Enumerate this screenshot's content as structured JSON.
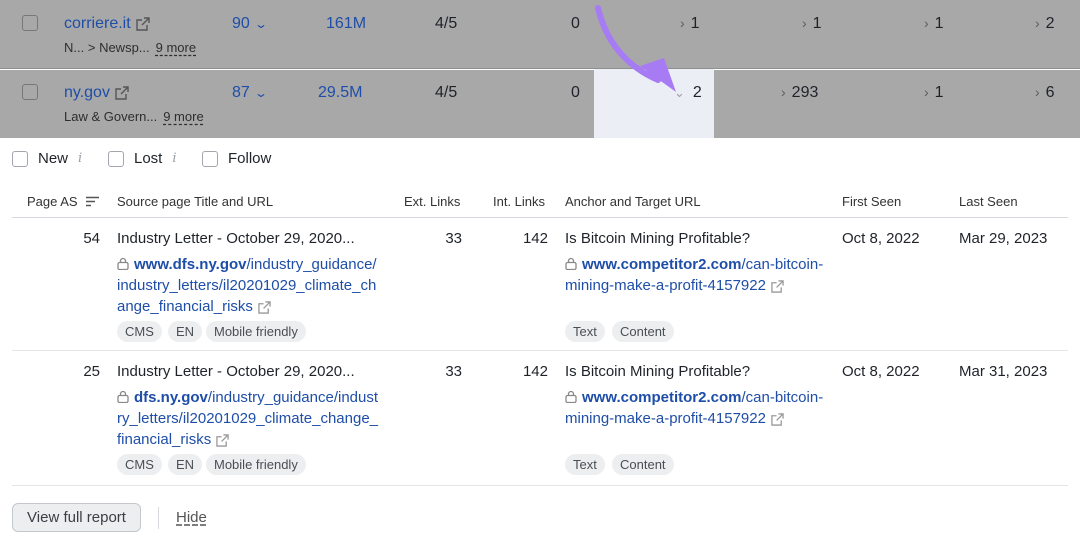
{
  "domains": [
    {
      "name": "corriere.it",
      "category": "N...",
      "category_sub": "> Newsp...",
      "more": "9 more",
      "authority_score": "90",
      "traffic": "161M",
      "rating": "4/5",
      "col_new": "0",
      "col_a": "1",
      "col_b": "1",
      "col_c": "1",
      "col_d": "2"
    },
    {
      "name": "ny.gov",
      "category": "Law & Govern...",
      "more": "9 more",
      "authority_score": "87",
      "traffic": "29.5M",
      "rating": "4/5",
      "col_new": "0",
      "col_a": "2",
      "col_b": "293",
      "col_c": "1",
      "col_d": "6"
    }
  ],
  "filters": {
    "new": "New",
    "lost": "Lost",
    "follow": "Follow",
    "info_glyph": "i"
  },
  "table": {
    "headers": {
      "page_as": "Page AS",
      "source": "Source page Title and URL",
      "ext_links": "Ext. Links",
      "int_links": "Int. Links",
      "anchor": "Anchor and Target URL",
      "first_seen": "First Seen",
      "last_seen": "Last Seen"
    },
    "rows": [
      {
        "page_as": "54",
        "title": "Industry Letter - October 29, 2020...",
        "source_url_bold": "www.dfs.ny.gov",
        "source_url_rest": "/industry_guidance/industry_letters/il20201029_climate_change_financial_risks",
        "ext_links": "33",
        "int_links": "142",
        "anchor": "Is Bitcoin Mining Profitable?",
        "target_url_bold": "www.competitor2.com",
        "target_url_rest": "/can-bitcoin-mining-make-a-profit-4157922",
        "first_seen": "Oct 8, 2022",
        "last_seen": "Mar 29, 2023",
        "source_tags": [
          "CMS",
          "EN",
          "Mobile friendly"
        ],
        "target_tags": [
          "Text",
          "Content"
        ]
      },
      {
        "page_as": "25",
        "title": "Industry Letter - October 29, 2020...",
        "source_url_bold": "dfs.ny.gov",
        "source_url_rest": "/industry_guidance/industry_letters/il20201029_climate_change_financial_risks",
        "ext_links": "33",
        "int_links": "142",
        "anchor": "Is Bitcoin Mining Profitable?",
        "target_url_bold": "www.competitor2.com",
        "target_url_rest": "/can-bitcoin-mining-make-a-profit-4157922",
        "first_seen": "Oct 8, 2022",
        "last_seen": "Mar 31, 2023",
        "source_tags": [
          "CMS",
          "EN",
          "Mobile friendly"
        ],
        "target_tags": [
          "Text",
          "Content"
        ]
      }
    ]
  },
  "footer": {
    "view_full_report": "View full report",
    "hide": "Hide"
  },
  "colors": {
    "link_blue": "#1e4ea8",
    "arrow_purple": "#a77bf3",
    "shaded_bg": "#a8a8a8"
  }
}
